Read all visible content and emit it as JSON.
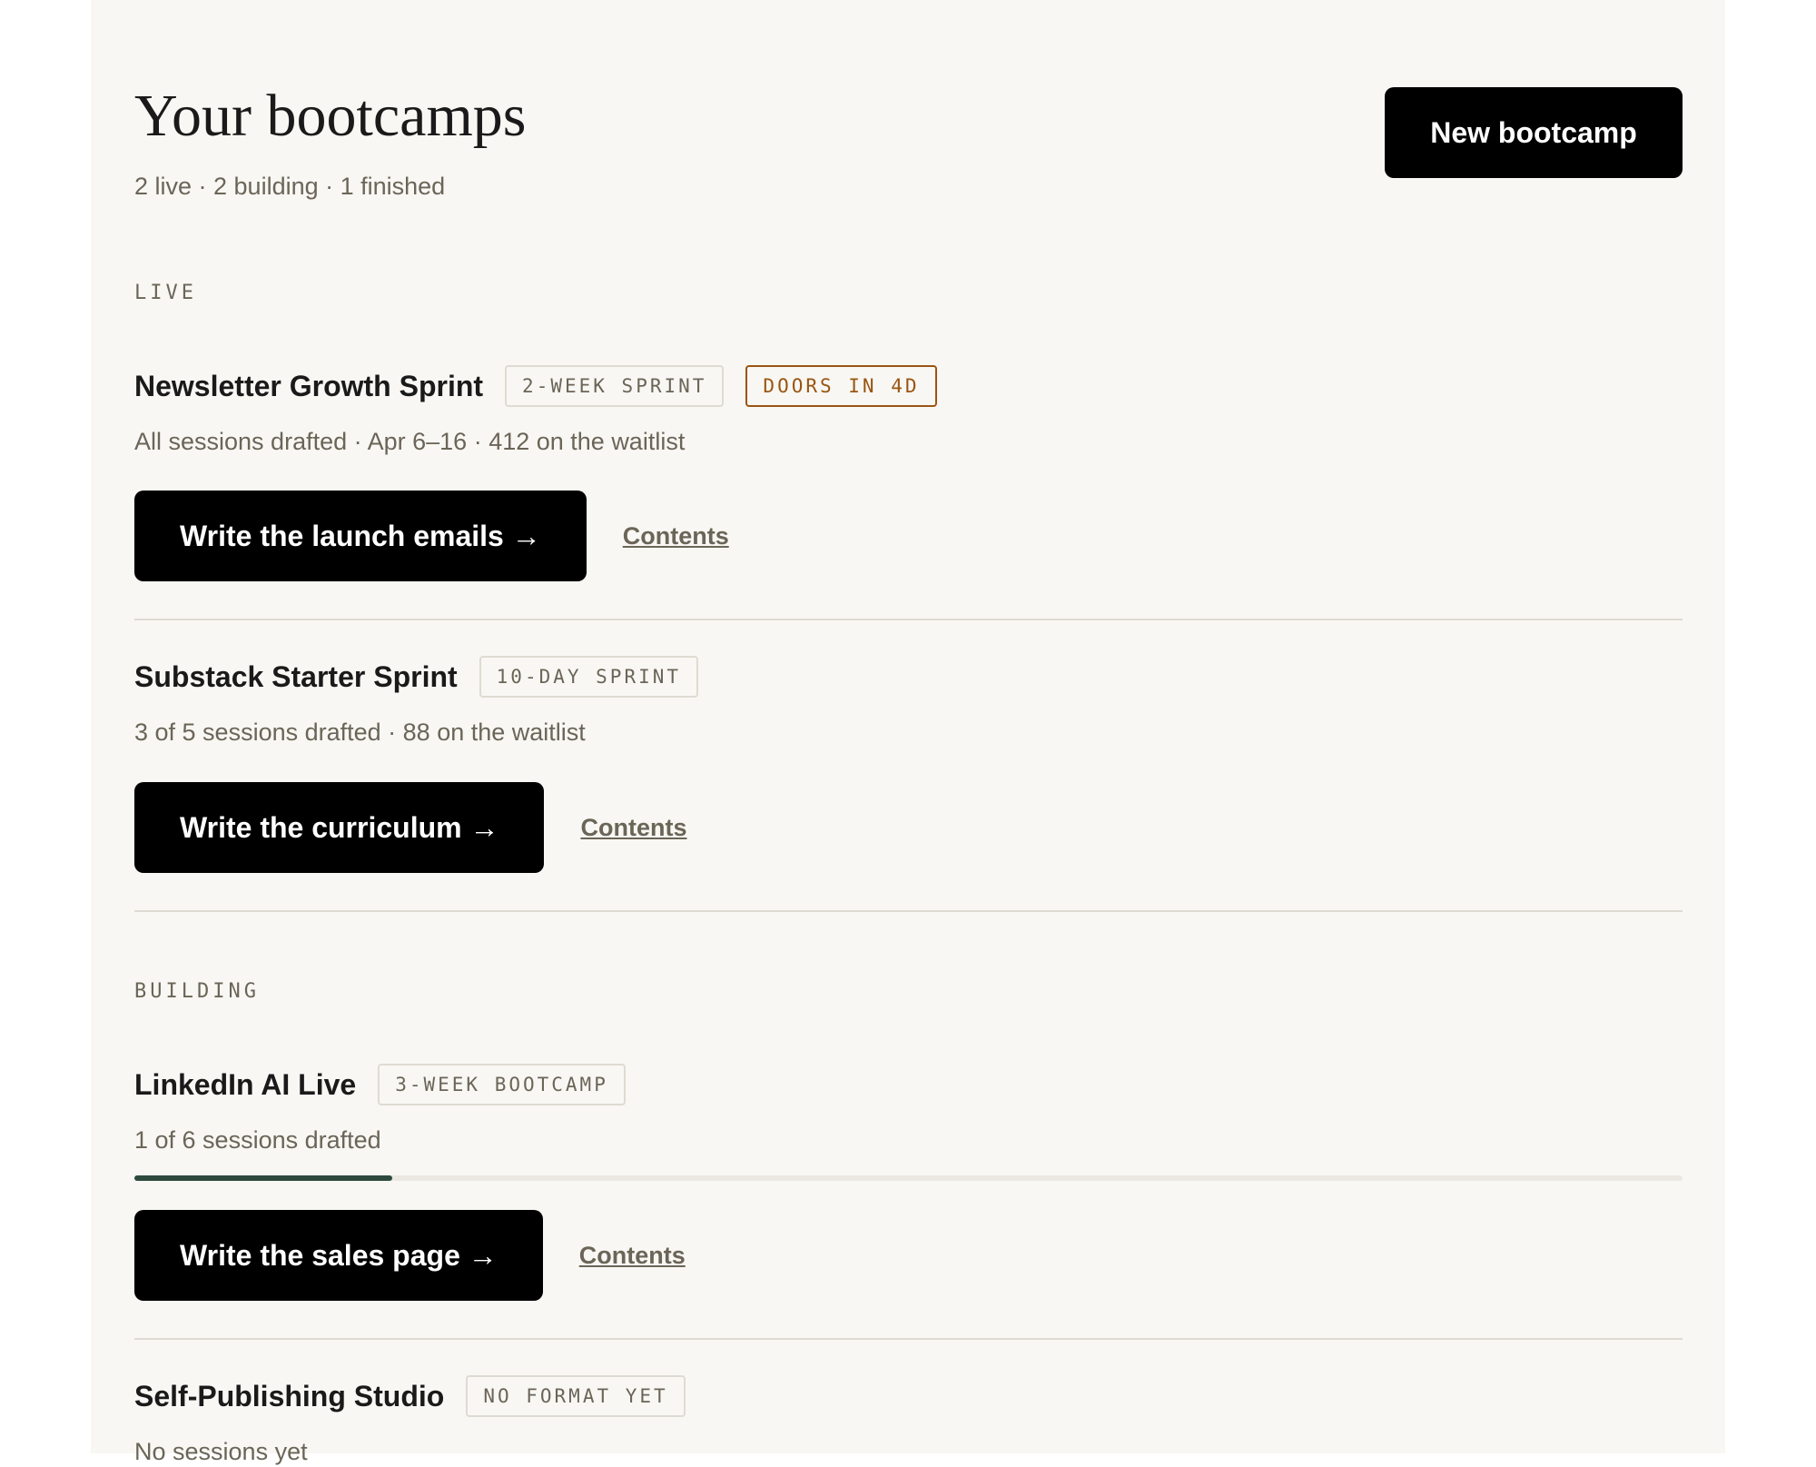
{
  "header": {
    "title": "Your bootcamps",
    "summary": "2 live · 2 building · 1 finished",
    "new_button": "New bootcamp"
  },
  "sections": {
    "live": {
      "label": "LIVE",
      "cards": [
        {
          "title": "Newsletter Growth Sprint",
          "badge": "2-WEEK SPRINT",
          "status_badge": "DOORS IN 4D",
          "meta": "All sessions drafted · Apr 6–16 · 412 on the waitlist",
          "action": "Write the launch emails →",
          "link": "Contents"
        },
        {
          "title": "Substack Starter Sprint",
          "badge": "10-DAY SPRINT",
          "meta": "3 of 5 sessions drafted · 88 on the waitlist",
          "action": "Write the curriculum →",
          "link": "Contents"
        }
      ]
    },
    "building": {
      "label": "BUILDING",
      "cards": [
        {
          "title": "LinkedIn AI Live",
          "badge": "3-WEEK BOOTCAMP",
          "meta": "1 of 6 sessions drafted",
          "progress": 0.1667,
          "action": "Write the sales page →",
          "link": "Contents"
        },
        {
          "title": "Self-Publishing Studio",
          "badge": "NO FORMAT YET",
          "meta": "No sessions yet"
        }
      ]
    }
  },
  "colors": {
    "background": "#f8f7f3",
    "accent": "#9a5512",
    "progress": "#2e4a3f"
  }
}
